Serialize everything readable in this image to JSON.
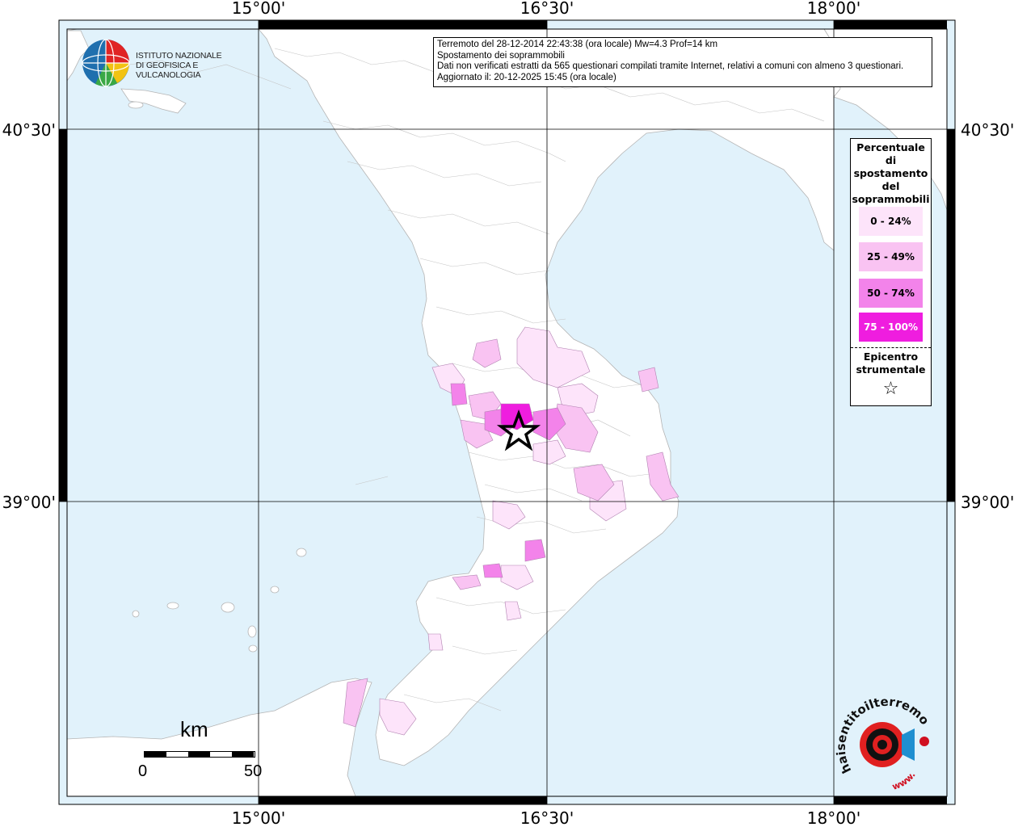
{
  "map": {
    "ticks_top": [
      "15°00'",
      "16°30'",
      "18°00'"
    ],
    "ticks_bottom": [
      "15°00'",
      "16°30'",
      "18°00'"
    ],
    "ticks_left": [
      "40°30'",
      "39°00'"
    ],
    "ticks_right": [
      "40°30'",
      "39°00'"
    ],
    "colors": {
      "sea": "#e1f2fb",
      "land": "#ffffff",
      "class_0_24": "#fde4fa",
      "class_25_49": "#f9c3f2",
      "class_50_74": "#f383ea",
      "class_75_100": "#ef1ddf"
    }
  },
  "info": {
    "line1": "Terremoto del 28-12-2014 22:43:38 (ora locale) Mw=4.3 Prof=14 km",
    "line2": "Spostamento dei soprammobili",
    "line3": "Dati non verificati estratti da 565 questionari compilati tramite Internet, relativi a comuni con almeno 3 questionari.",
    "line4": "Aggiornato il: 20-12-2025 15:45 (ora locale)"
  },
  "legend": {
    "title_lines": [
      "Percentuale",
      "di",
      "spostamento",
      "del",
      "soprammobili"
    ],
    "classes": [
      {
        "label": "0 - 24%",
        "color": "#fde4fa",
        "text_color": "#000000"
      },
      {
        "label": "25 - 49%",
        "color": "#f9c3f2",
        "text_color": "#000000"
      },
      {
        "label": "50 - 74%",
        "color": "#f383ea",
        "text_color": "#000000"
      },
      {
        "label": "75 - 100%",
        "color": "#ef1ddf",
        "text_color": "#ffffff"
      }
    ],
    "epicenter_lines": [
      "Epicentro",
      "strumentale"
    ],
    "star_icon": "☆"
  },
  "logo": {
    "line1": "ISTITUTO NAZIONALE",
    "line2": "DI GEOFISICA E VULCANOLOGIA"
  },
  "scale": {
    "unit": "km",
    "start": "0",
    "end": "50"
  },
  "badge": {
    "text": "haisentitoilterremoto.it",
    "www": "www."
  }
}
